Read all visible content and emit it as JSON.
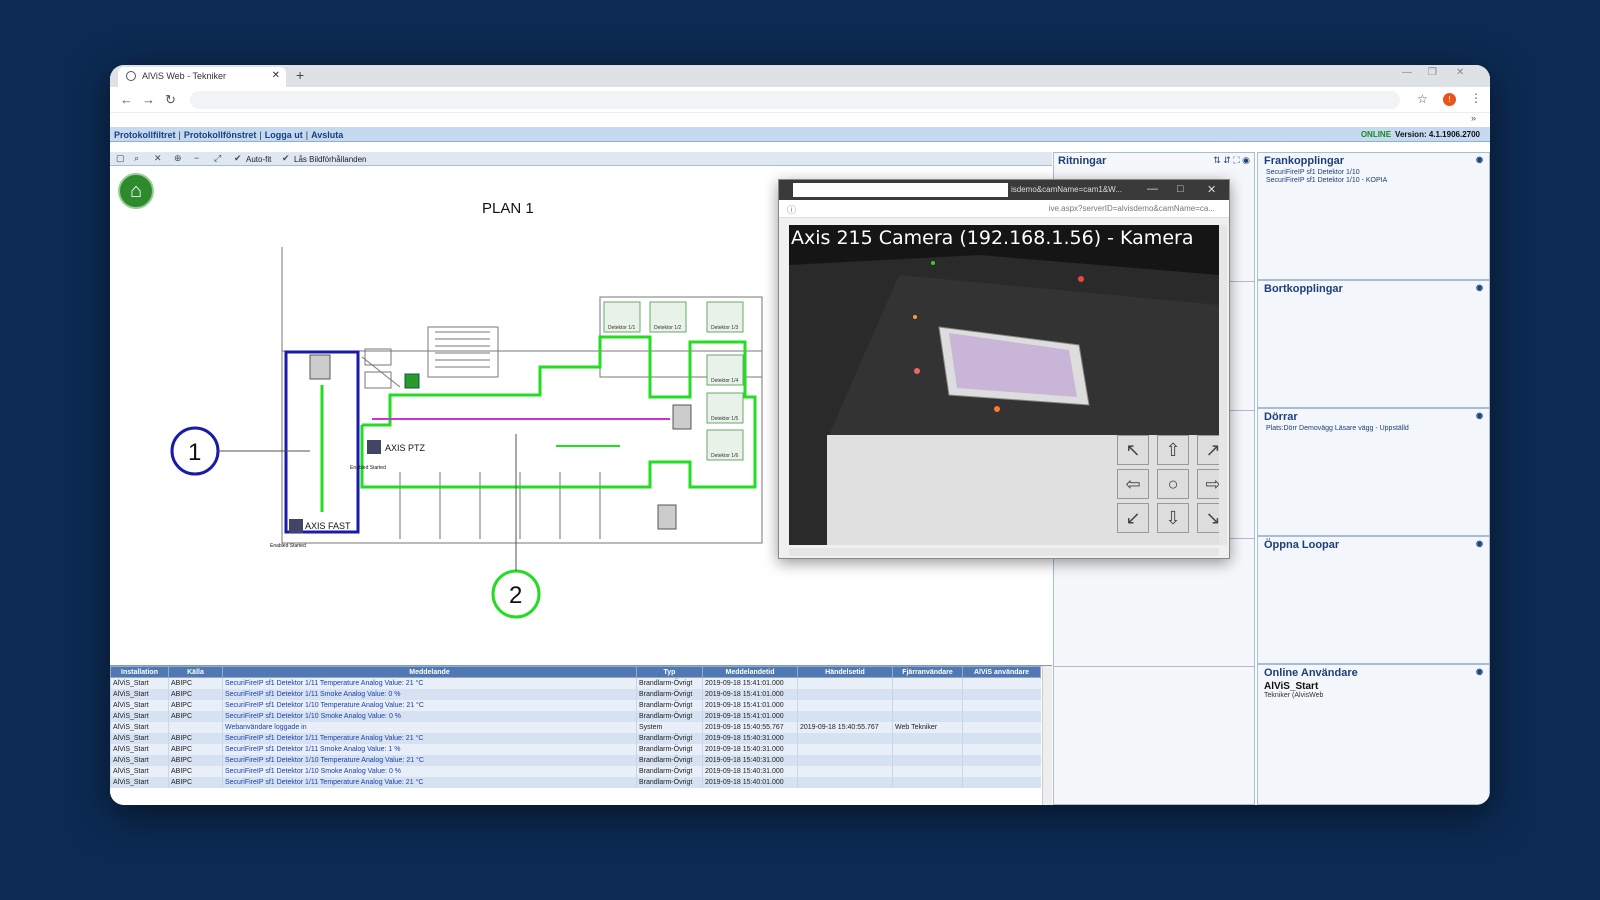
{
  "browser": {
    "tab_title": "AlViS Web - Tekniker",
    "new_tab": "+",
    "ext_badge": "!"
  },
  "menu": {
    "items": [
      "Protokollfiltret",
      "Protokollfönstret",
      "Logga ut",
      "Avsluta"
    ],
    "online": "ONLINE",
    "version": "Version: 4.1.1906.2700"
  },
  "map_toolbar": {
    "autofit": "Auto-fit",
    "aspect": "Lås Bildförhållanden"
  },
  "map": {
    "title": "PLAN 1",
    "marker1": "1",
    "marker2": "2",
    "axis_ptz": "AXIS PTZ",
    "axis_fast": "AXIS FAST",
    "enabled_started": "Enabled Started",
    "detectors": [
      "Detektor 1/1",
      "Detektor 1/2",
      "Detektor 1/3",
      "Detektor 1/4",
      "Detektor 1/5",
      "Detektor 1/6"
    ]
  },
  "camera_popup": {
    "title": "isdemo&camName=cam1&W...",
    "url": "ive.aspx?serverID=alvisdemo&camName=ca...",
    "caption": "Axis 215 Camera (192.168.1.56) - Kamera"
  },
  "middle": {
    "ritningar": "Ritningar"
  },
  "panels": {
    "frankopplingar": {
      "title": "Frankopplingar",
      "lines": [
        "SecuriFireIP sf1 Detektor 1/10",
        "SecuriFireIP sf1 Detektor 1/10 - KOPIA"
      ]
    },
    "bortkopplingar": {
      "title": "Bortkopplingar"
    },
    "dorrar": {
      "title": "Dörrar",
      "lines": [
        "Plats:Dörr Demovägg Läsare vägg - Uppställd"
      ]
    },
    "oppna_loopar": {
      "title": "Öppna Loopar"
    },
    "online_users": {
      "title": "Online Användare",
      "user": "AlViS_Start",
      "role": "Tekniker (AlvisWeb"
    }
  },
  "log": {
    "headers": [
      "Installation",
      "Källa",
      "Meddelande",
      "Typ",
      "Meddelandetid",
      "Händelsetid",
      "Fjärranvändare",
      "AlViS användare"
    ],
    "rows": [
      [
        "AlViS_Start",
        "ABIPC",
        "SecuriFireIP sf1 Detektor 1/11 Temperature Analog Value: 21 °C",
        "Brandlarm-Övrigt",
        "2019-09-18 15:41:01.000",
        "",
        "",
        ""
      ],
      [
        "AlViS_Start",
        "ABIPC",
        "SecuriFireIP sf1 Detektor 1/11 Smoke Analog Value: 0 %",
        "Brandlarm-Övrigt",
        "2019-09-18 15:41:01.000",
        "",
        "",
        ""
      ],
      [
        "AlViS_Start",
        "ABIPC",
        "SecuriFireIP sf1 Detektor 1/10 Temperature Analog Value: 21 °C",
        "Brandlarm-Övrigt",
        "2019-09-18 15:41:01.000",
        "",
        "",
        ""
      ],
      [
        "AlViS_Start",
        "ABIPC",
        "SecuriFireIP sf1 Detektor 1/10 Smoke Analog Value: 0 %",
        "Brandlarm-Övrigt",
        "2019-09-18 15:41:01.000",
        "",
        "",
        ""
      ],
      [
        "AlViS_Start",
        "",
        "Webanvändare loggade in",
        "System",
        "2019-09-18 15:40:55.767",
        "2019-09-18 15:40:55.767",
        "Web Tekniker",
        ""
      ],
      [
        "AlViS_Start",
        "ABIPC",
        "SecuriFireIP sf1 Detektor 1/11 Temperature Analog Value: 21 °C",
        "Brandlarm-Övrigt",
        "2019-09-18 15:40:31.000",
        "",
        "",
        ""
      ],
      [
        "AlViS_Start",
        "ABIPC",
        "SecuriFireIP sf1 Detektor 1/11 Smoke Analog Value: 1 %",
        "Brandlarm-Övrigt",
        "2019-09-18 15:40:31.000",
        "",
        "",
        ""
      ],
      [
        "AlViS_Start",
        "ABIPC",
        "SecuriFireIP sf1 Detektor 1/10 Temperature Analog Value: 21 °C",
        "Brandlarm-Övrigt",
        "2019-09-18 15:40:31.000",
        "",
        "",
        ""
      ],
      [
        "AlViS_Start",
        "ABIPC",
        "SecuriFireIP sf1 Detektor 1/10 Smoke Analog Value: 0 %",
        "Brandlarm-Övrigt",
        "2019-09-18 15:40:31.000",
        "",
        "",
        ""
      ],
      [
        "AlViS_Start",
        "ABIPC",
        "SecuriFireIP sf1 Detektor 1/11 Temperature Analog Value: 21 °C",
        "Brandlarm-Övrigt",
        "2019-09-18 15:40:01.000",
        "",
        "",
        ""
      ]
    ]
  },
  "colors": {
    "page_bg": "#0c2a52",
    "header_blue": "#1d3f7a",
    "zone_green": "#22dd22",
    "zone_blue": "#1a1aaa"
  }
}
